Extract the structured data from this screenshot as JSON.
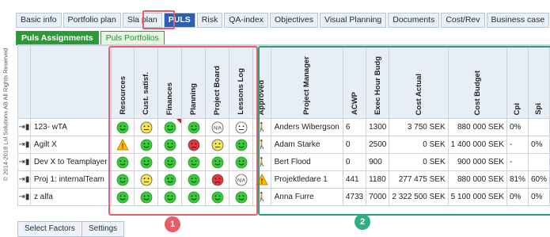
{
  "copyright": "© 2014-2018 Lnl Solutions AB All Rights Reserved",
  "tabs": [
    {
      "label": "Basic info"
    },
    {
      "label": "Portfolio plan"
    },
    {
      "label": "Sla plan"
    },
    {
      "label": "PULS",
      "active": true
    },
    {
      "label": "Risk"
    },
    {
      "label": "QA-index"
    },
    {
      "label": "Objectives"
    },
    {
      "label": "Visual Planning"
    },
    {
      "label": "Documents"
    },
    {
      "label": "Cost/Rev"
    },
    {
      "label": "Business case"
    }
  ],
  "subtabs": [
    {
      "label": "Puls Assignments",
      "active": true
    },
    {
      "label": "Puls Portfolios"
    }
  ],
  "factor_headers": [
    "Resources",
    "Cust. satisf.",
    "Finances",
    "Planning",
    "Project Board",
    "Lessons Log"
  ],
  "other_headers": {
    "approved": "Approved",
    "project_manager": "Project Manager",
    "acwp": "ACWP",
    "exec_hour_budget": "Exec Hour Budg",
    "cost_actual": "Cost Actual",
    "cost_budget": "Cost Budget",
    "cpi": "Cpi",
    "spi": "Spi"
  },
  "rows": [
    {
      "name": "123- wTA",
      "factors": [
        "green",
        "yellow",
        "green-flag",
        "green",
        "na",
        "white"
      ],
      "approved": "walker",
      "manager": "Anders Wibergson",
      "acwp": "6",
      "exec": "1300",
      "cost_actual": "3 750 SEK",
      "cost_budget": "880 000 SEK",
      "cpi": "0%",
      "spi": ""
    },
    {
      "name": "Agilt X",
      "factors": [
        "warning",
        "green",
        "green",
        "red",
        "yellow",
        "green"
      ],
      "approved": "walker",
      "manager": "Adam Starke",
      "acwp": "0",
      "exec": "2500",
      "cost_actual": "0 SEK",
      "cost_budget": "1 400 000 SEK",
      "cpi": "-",
      "spi": "0%"
    },
    {
      "name": "Dev X to Teamplayer",
      "factors": [
        "green",
        "green",
        "green",
        "green",
        "green",
        "green"
      ],
      "approved": "walker",
      "manager": "Bert Flood",
      "acwp": "0",
      "exec": "900",
      "cost_actual": "0 SEK",
      "cost_budget": "900 000 SEK",
      "cpi": "-",
      "spi": ""
    },
    {
      "name": "Proj 1: internalTeam",
      "factors": [
        "green",
        "yellow",
        "green",
        "green",
        "red",
        "na"
      ],
      "approved": "warning",
      "manager": "Projektledare 1",
      "acwp": "441",
      "exec": "1180",
      "cost_actual": "277 475 SEK",
      "cost_budget": "880 000 SEK",
      "cpi": "81%",
      "spi": "60%"
    },
    {
      "name": "z alfa",
      "factors": [
        "green",
        "green",
        "green",
        "green",
        "green",
        "green"
      ],
      "approved": "walker",
      "manager": "Anna Furre",
      "acwp": "4733",
      "exec": "7000",
      "cost_actual": "2 322 500 SEK",
      "cost_budget": "5 100 000 SEK",
      "cpi": "0%",
      "spi": "0%"
    }
  ],
  "badges": {
    "red": "1",
    "teal": "2"
  },
  "buttons": {
    "select_factors": "Select Factors",
    "settings": "Settings"
  },
  "colors": {
    "green": "#3cc83c",
    "yellow": "#f6e55a",
    "red": "#e8343c",
    "tab_active": "#2a5fb3",
    "subtab_active": "#2d9b35",
    "red_outline": "#e8606c",
    "teal_outline": "#2aa27c"
  }
}
